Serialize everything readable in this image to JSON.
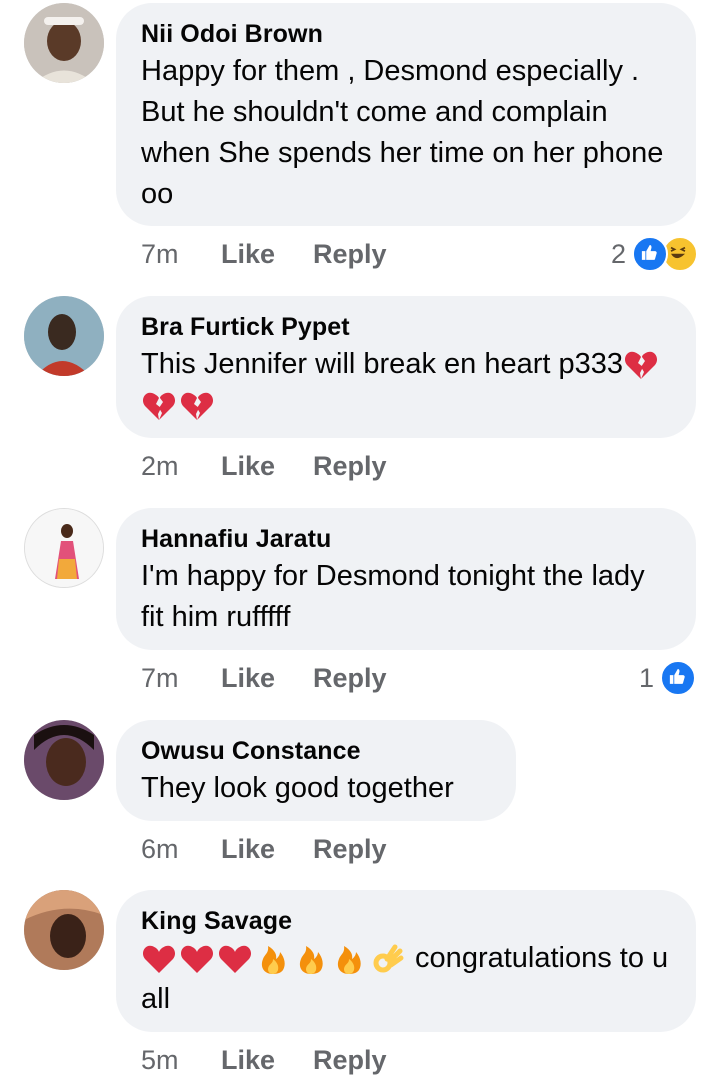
{
  "comments": [
    {
      "author": "Nii Odoi Brown",
      "text": "Happy for them , Desmond especially . But he shouldn't come and complain when She spends her time on her phone oo",
      "time": "7m",
      "like": "Like",
      "reply": "Reply",
      "reactions": {
        "count": "2",
        "icons": [
          "like-icon",
          "haha-icon"
        ]
      }
    },
    {
      "author": "Bra Furtick Pypet",
      "text": "This Jennifer will break en heart p333",
      "emojis": [
        "broken-heart",
        "broken-heart",
        "broken-heart"
      ],
      "time": "2m",
      "like": "Like",
      "reply": "Reply"
    },
    {
      "author": "Hannafiu Jaratu",
      "text": "I'm happy for Desmond tonight the lady fit him rufffff",
      "time": "7m",
      "like": "Like",
      "reply": "Reply",
      "reactions": {
        "count": "1",
        "icons": [
          "like-icon"
        ]
      }
    },
    {
      "author": "Owusu Constance",
      "text": "They look good together",
      "time": "6m",
      "like": "Like",
      "reply": "Reply"
    },
    {
      "author": "King Savage",
      "emojis": [
        "red-heart",
        "red-heart",
        "red-heart",
        "fire",
        "fire",
        "fire",
        "ok-hand"
      ],
      "text": " congratulations to u all",
      "time": "5m",
      "like": "Like",
      "reply": "Reply"
    }
  ],
  "colors": {
    "bubble": "#f0f2f5",
    "meta": "#65676b",
    "like_blue": "#1877f2"
  }
}
